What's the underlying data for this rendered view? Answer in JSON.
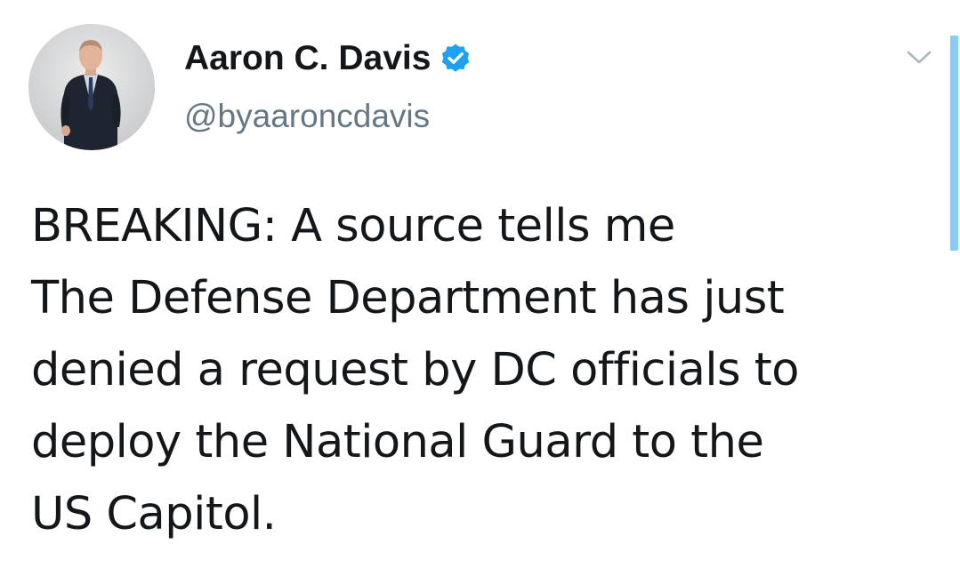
{
  "author": {
    "display_name": "Aaron C. Davis",
    "handle": "@byaaroncdavis",
    "verified": true,
    "avatar_icon": "profile-photo"
  },
  "tweet": {
    "lines": [
      "BREAKING: A source tells me",
      "The Defense Department has just",
      "denied a request by DC officials to",
      "deploy the National Guard to the",
      "US Capitol."
    ]
  },
  "icons": {
    "verified": "verified-badge-icon",
    "menu": "chevron-down-icon"
  },
  "colors": {
    "verified_blue": "#1da1f2",
    "handle_gray": "#657786",
    "text": "#14171a",
    "chevron_gray": "#aab8c2",
    "scrollbar": "#8ec9ef"
  }
}
